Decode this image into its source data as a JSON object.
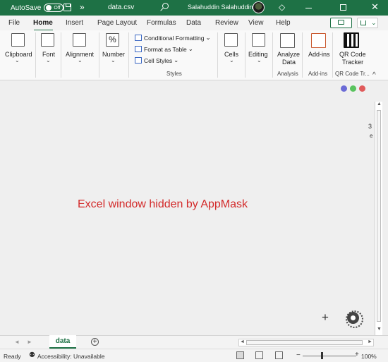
{
  "titlebar": {
    "autosave_label": "AutoSave",
    "autosave_state": "Off",
    "more_icon": "»",
    "filename": "data.csv",
    "user_name": "Salahuddin Salahuddin",
    "close_glyph": "✕",
    "diamond_glyph": "◇"
  },
  "tabs": [
    "File",
    "Home",
    "Insert",
    "Page Layout",
    "Formulas",
    "Data",
    "Review",
    "View",
    "Help"
  ],
  "active_tab": "Home",
  "ribbon": {
    "clipboard": "Clipboard",
    "font": "Font",
    "alignment": "Alignment",
    "number": "Number",
    "number_glyph": "%",
    "conditional_formatting": "Conditional Formatting",
    "format_as_table": "Format as Table",
    "cell_styles": "Cell Styles",
    "styles_group": "Styles",
    "cells": "Cells",
    "editing": "Editing",
    "analyze_data_1": "Analyze",
    "analyze_data_2": "Data",
    "analysis_group": "Analysis",
    "addins": "Add-ins",
    "addins_group": "Add-ins",
    "qr_1": "QR Code",
    "qr_2": "Tracker",
    "qr_group": "QR Code Tr...",
    "chevron": "⌄",
    "collapse": "^"
  },
  "workarea": {
    "mask_message": "Excel window hidden by AppMask",
    "side_snip_1": "3",
    "side_snip_2": "e",
    "plus": "+",
    "dot_colors": [
      "#6b6bd6",
      "#59c35e",
      "#e05a5a"
    ]
  },
  "sheets": {
    "active": "data",
    "add": "+",
    "left_arrow": "◄",
    "right_arrow": "►"
  },
  "status": {
    "ready": "Ready",
    "accessibility": "Accessibility: Unavailable",
    "accessibility_glyph": "⚉",
    "zoom_minus": "−",
    "zoom_plus": "+",
    "zoom": "100%"
  },
  "colors": {
    "brand": "#1e7145",
    "mask_text": "#d32a2a"
  }
}
